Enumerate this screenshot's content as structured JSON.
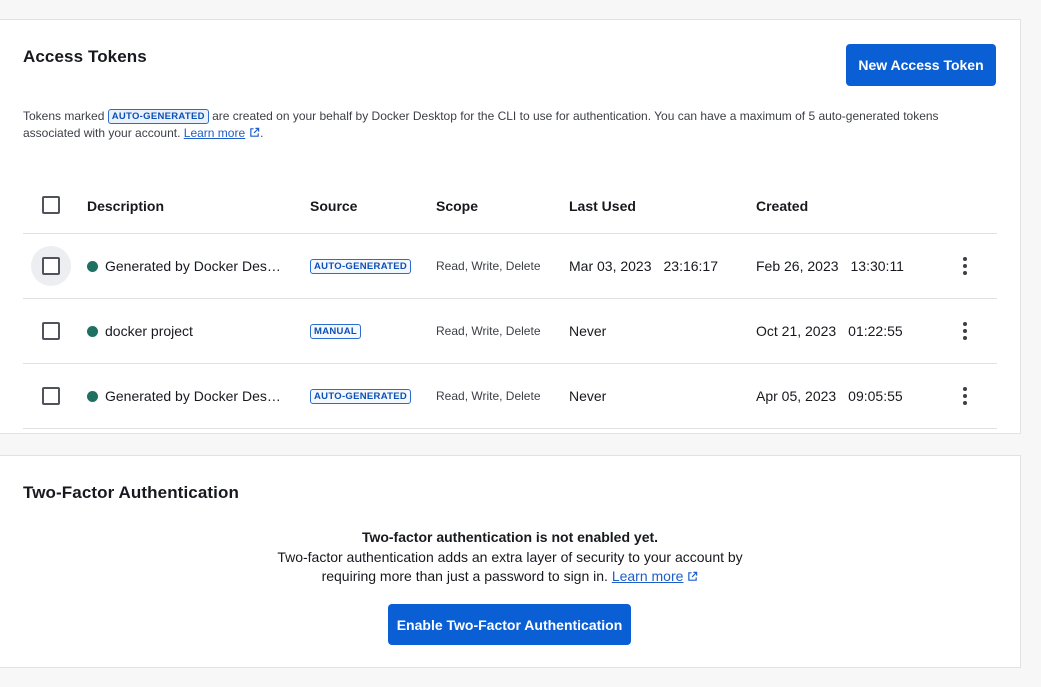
{
  "tokens": {
    "title": "Access Tokens",
    "new_button": "New Access Token",
    "info": {
      "prefix": "Tokens marked",
      "badge": "AUTO-GENERATED",
      "middle": "are created on your behalf by Docker Desktop for the CLI to use for authentication. You can have a maximum of 5 auto-generated tokens associated with your account.",
      "link": "Learn more",
      "suffix": "."
    },
    "columns": {
      "description": "Description",
      "source": "Source",
      "scope": "Scope",
      "last_used": "Last Used",
      "created": "Created"
    },
    "rows": [
      {
        "description": "Generated by Docker Desktop",
        "source": "AUTO-GENERATED",
        "scope": "Read, Write, Delete",
        "last_used_date": "Mar 03, 2023",
        "last_used_time": "23:16:17",
        "created_date": "Feb 26, 2023",
        "created_time": "13:30:11",
        "status_color": "#1e7061"
      },
      {
        "description": "docker project",
        "source": "MANUAL",
        "scope": "Read, Write, Delete",
        "last_used_date": "Never",
        "last_used_time": "",
        "created_date": "Oct 21, 2023",
        "created_time": "01:22:55",
        "status_color": "#1e7061"
      },
      {
        "description": "Generated by Docker Desktop",
        "source": "AUTO-GENERATED",
        "scope": "Read, Write, Delete",
        "last_used_date": "Never",
        "last_used_time": "",
        "created_date": "Apr 05, 2023",
        "created_time": "09:05:55",
        "status_color": "#1e7061"
      }
    ]
  },
  "twofa": {
    "title": "Two-Factor Authentication",
    "heading": "Two-factor authentication is not enabled yet.",
    "line1": "Two-factor authentication adds an extra layer of security to your account by",
    "line2": "requiring more than just a password to sign in.",
    "link": "Learn more",
    "button": "Enable Two-Factor Authentication"
  },
  "colors": {
    "primary": "#0b5fd4",
    "link": "#1d5ec9",
    "status_active": "#1e7061"
  },
  "icons": {
    "external_link": "external-link-icon",
    "row_menu": "kebab-menu-icon"
  }
}
